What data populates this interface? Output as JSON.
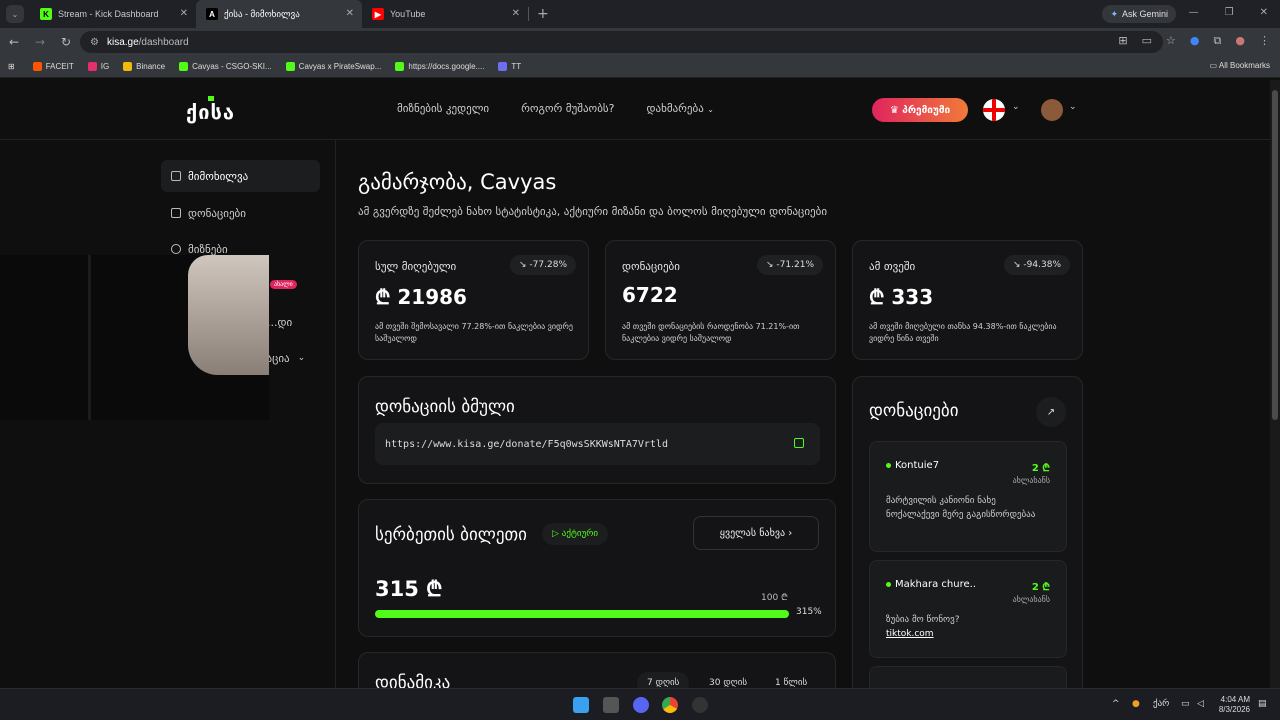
{
  "browser": {
    "tabs": [
      {
        "label": "Stream - Kick Dashboard",
        "fav_color": "#53fc18",
        "fav_letter": "K"
      },
      {
        "label": "ქისა - მიმოხილვა",
        "fav_color": "#000000",
        "fav_letter": "A"
      },
      {
        "label": "YouTube",
        "fav_color": "#ff0000",
        "fav_letter": "▶"
      }
    ],
    "ask_gemini": "Ask Gemini",
    "url_host": "kisa.ge",
    "url_path": "/dashboard",
    "bookmarks": [
      {
        "label": "FACEIT",
        "color": "#ff5500"
      },
      {
        "label": "IG",
        "color": "#e1306c"
      },
      {
        "label": "Binance",
        "color": "#f0b90b"
      },
      {
        "label": "Cavyas - CSGO-SKI...",
        "color": "#53fc18"
      },
      {
        "label": "Cavyas x PirateSwap...",
        "color": "#53fc18"
      },
      {
        "label": "https://docs.google....",
        "color": "#53fc18"
      },
      {
        "label": "TT",
        "color": "#6e6ef0"
      }
    ],
    "all_bookmarks": "All Bookmarks"
  },
  "site": {
    "logo": "ქისა",
    "nav": [
      "მიზნების კედელი",
      "როგორ მუშაობს?",
      "დახმარება"
    ],
    "premium": "♛ პრემიუმი"
  },
  "sidebar": {
    "items": [
      "მიმოხილვა",
      "დონაციები",
      "მიზნები",
      "...დი",
      "...აცია"
    ],
    "new_badge": "ახალი"
  },
  "main": {
    "greeting": "გამარჯობა, Cavyas",
    "subtitle": "ამ გვერდზე შეძლებ ნახო სტატისტიკა, აქტიური მიზანი და ბოლოს მიღებული დონაციები",
    "stats": [
      {
        "title": "სულ მიღებული",
        "change": "↘ -77.28%",
        "value": "₾ 21986",
        "note": "ამ თვეში შემოსავალი 77.28%-ით ნაკლებია ვიდრე საშუალოდ"
      },
      {
        "title": "დონაციები",
        "change": "↘ -71.21%",
        "value": "6722",
        "note": "ამ თვეში დონაციების რაოდენობა 71.21%-ით ნაკლებია ვიდრე საშუალოდ"
      },
      {
        "title": "ამ თვეში",
        "change": "↘ -94.38%",
        "value": "₾ 333",
        "note": "ამ თვეში მიღებული თანხა 94.38%-ით ნაკლებია ვიდრე წინა თვეში"
      }
    ],
    "link_card": {
      "title": "დონაციის ბმული",
      "url": "https://www.kisa.ge/donate/F5q0wsSKKWsNTA7Vrtld"
    },
    "ticket": {
      "title": "სერბეთის ბილეთი",
      "status": "▷ აქტიური",
      "view_all": "ყველას ნახვა  ›",
      "amount": "315 ₾",
      "goal": "100 ₾",
      "percent": "315%"
    },
    "dynamics": {
      "title": "დინამიკა",
      "ranges": [
        "7 დღის",
        "30 დღის",
        "1 წლის"
      ]
    },
    "donations": {
      "title": "დონაციები",
      "items": [
        {
          "name": "Kontuie7",
          "amount": "2 ₾",
          "time": "ახლახანს",
          "message": "მარტვილის კანიონი ნახე ნოქალაქევი მერე გაგისწორდებაა",
          "link": ""
        },
        {
          "name": "Makhara chure..",
          "amount": "2 ₾",
          "time": "ახლახანს",
          "message": "ზუბია მო წონოვ?",
          "link": "tiktok.com"
        }
      ]
    }
  },
  "taskbar": {
    "time": "4:04 AM",
    "date": "8/3/2026",
    "lang": "ქარ"
  }
}
